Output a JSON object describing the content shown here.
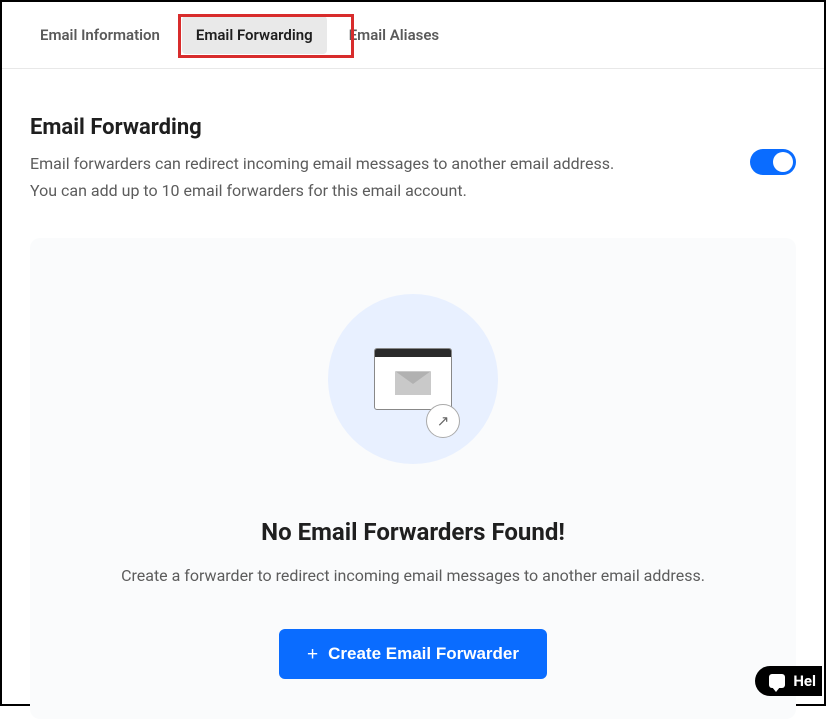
{
  "tabs": {
    "info": "Email Information",
    "forwarding": "Email Forwarding",
    "aliases": "Email Aliases"
  },
  "section": {
    "title": "Email Forwarding",
    "desc_line1": "Email forwarders can redirect incoming email messages to another email address.",
    "desc_line2": "You can add up to 10 email forwarders for this email account."
  },
  "empty": {
    "title": "No Email Forwarders Found!",
    "desc": "Create a forwarder to redirect incoming email messages to another email address.",
    "button": "Create Email Forwarder"
  },
  "help": {
    "label": "Hel"
  }
}
